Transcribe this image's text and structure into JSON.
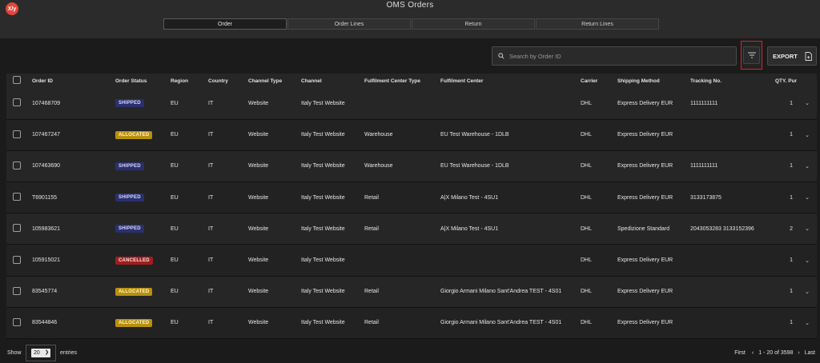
{
  "app": {
    "logo_text": "X/y",
    "title": "OMS Orders"
  },
  "tabs": [
    {
      "label": "Order",
      "active": true
    },
    {
      "label": "Order Lines",
      "active": false
    },
    {
      "label": "Return",
      "active": false
    },
    {
      "label": "Return Lines",
      "active": false
    }
  ],
  "toolbar": {
    "search_placeholder": "Search by Order ID",
    "search_value": "",
    "export_label": "EXPORT"
  },
  "table": {
    "headers": [
      "Order ID",
      "Order Status",
      "Region",
      "Country",
      "Channel Type",
      "Channel",
      "Fulfilment Center Type",
      "Fulfilment Center",
      "Carrier",
      "Shipping Method",
      "Tracking No.",
      "QTY. Pur"
    ],
    "rows": [
      {
        "order_id": "107468709",
        "status": "SHIPPED",
        "region": "EU",
        "country": "IT",
        "channel_type": "Website",
        "channel": "Italy Test Website",
        "fc_type": "",
        "fc": "",
        "carrier": "DHL",
        "shipping": "Express Delivery EUR",
        "tracking": "1111111111",
        "qty": "1"
      },
      {
        "order_id": "107467247",
        "status": "ALLOCATED",
        "region": "EU",
        "country": "IT",
        "channel_type": "Website",
        "channel": "Italy Test Website",
        "fc_type": "Warehouse",
        "fc": "EU Test Warehouse - 1DLB",
        "carrier": "DHL",
        "shipping": "Express Delivery EUR",
        "tracking": "",
        "qty": "1"
      },
      {
        "order_id": "107463690",
        "status": "SHIPPED",
        "region": "EU",
        "country": "IT",
        "channel_type": "Website",
        "channel": "Italy Test Website",
        "fc_type": "Warehouse",
        "fc": "EU Test Warehouse - 1DLB",
        "carrier": "DHL",
        "shipping": "Express Delivery EUR",
        "tracking": "1111111111",
        "qty": "1"
      },
      {
        "order_id": "T6901155",
        "status": "SHIPPED",
        "region": "EU",
        "country": "IT",
        "channel_type": "Website",
        "channel": "Italy Test Website",
        "fc_type": "Retail",
        "fc": "A|X Milano Test - 4SU1",
        "carrier": "DHL",
        "shipping": "Express Delivery EUR",
        "tracking": "3133173875",
        "qty": "1"
      },
      {
        "order_id": "105983621",
        "status": "SHIPPED",
        "region": "EU",
        "country": "IT",
        "channel_type": "Website",
        "channel": "Italy Test Website",
        "fc_type": "Retail",
        "fc": "A|X Milano Test - 4SU1",
        "carrier": "DHL",
        "shipping": "Spedizione Standard",
        "tracking": "2043053283 3133152396",
        "qty": "2"
      },
      {
        "order_id": "105915021",
        "status": "CANCELLED",
        "region": "EU",
        "country": "IT",
        "channel_type": "Website",
        "channel": "Italy Test Website",
        "fc_type": "",
        "fc": "",
        "carrier": "DHL",
        "shipping": "Express Delivery EUR",
        "tracking": "",
        "qty": "1"
      },
      {
        "order_id": "83545774",
        "status": "ALLOCATED",
        "region": "EU",
        "country": "IT",
        "channel_type": "Website",
        "channel": "Italy Test Website",
        "fc_type": "Retail",
        "fc": "Giorgio Armani Milano Sant'Andrea TEST - 4S01",
        "carrier": "DHL",
        "shipping": "Express Delivery EUR",
        "tracking": "",
        "qty": "1"
      },
      {
        "order_id": "83544846",
        "status": "ALLOCATED",
        "region": "EU",
        "country": "IT",
        "channel_type": "Website",
        "channel": "Italy Test Website",
        "fc_type": "Retail",
        "fc": "Giorgio Armani Milano Sant'Andrea TEST - 4S01",
        "carrier": "DHL",
        "shipping": "Express Delivery EUR",
        "tracking": "",
        "qty": "1"
      }
    ]
  },
  "footer": {
    "show_label": "Show",
    "entries_value": "20",
    "entries_label": "entries",
    "first_label": "First",
    "range_label": "1 - 20 of 3598",
    "last_label": "Last"
  },
  "colors": {
    "accent_red": "#d9232d",
    "shipped": "#2b2f70",
    "allocated": "#b8900c",
    "cancelled": "#a11d1d"
  }
}
